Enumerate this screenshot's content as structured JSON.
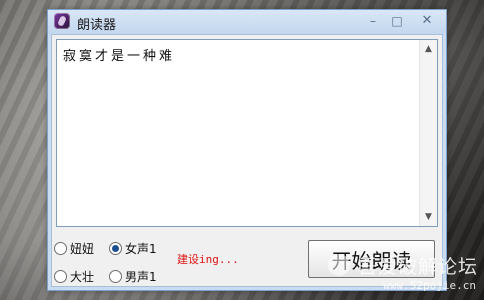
{
  "window": {
    "title": "朗读器"
  },
  "title_controls": {
    "minimize_icon": "minimize-icon",
    "maximize_icon": "maximize-icon",
    "close_icon": "close-icon",
    "minimize": "–",
    "maximize": "□",
    "close": "✕"
  },
  "textarea": {
    "content": "寂寞才是一种难"
  },
  "scrollbar": {
    "up": "▲",
    "down": "▼"
  },
  "voices": [
    {
      "label": "妞妞",
      "checked": false
    },
    {
      "label": "女声1",
      "checked": true
    },
    {
      "label": "大壮",
      "checked": false
    },
    {
      "label": "男声1",
      "checked": false
    }
  ],
  "status": "建设ing...",
  "start_button": "开始朗读",
  "watermark": {
    "text": "吾爱破解论坛",
    "url": "www.52pojie.cn"
  }
}
